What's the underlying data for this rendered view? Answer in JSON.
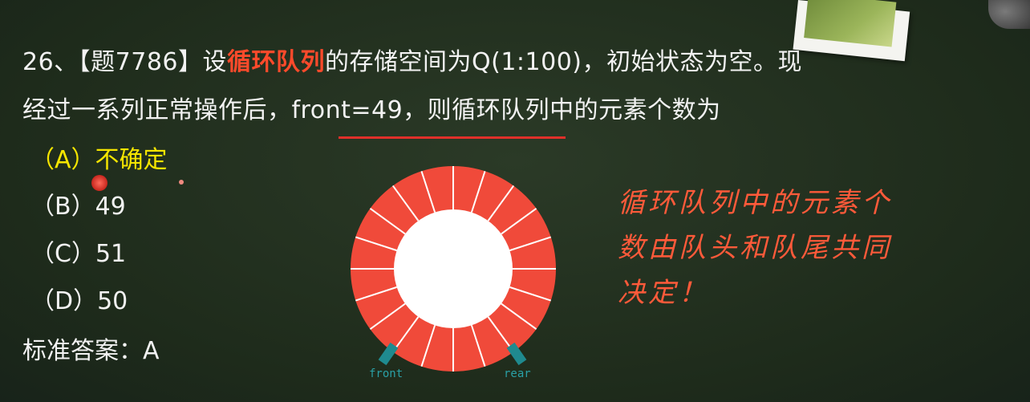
{
  "question": {
    "line1_prefix": "26、【题7786】设",
    "line1_highlight": "循环队列",
    "line1_suffix": "的存储空间为Q(1:100)，初始状态为空。现",
    "line2": "经过一系列正常操作后，front=49，则循环队列中的元素个数为"
  },
  "options": [
    {
      "label": "（A）不确定",
      "selected": true
    },
    {
      "label": "（B）49"
    },
    {
      "label": "（C）51"
    },
    {
      "label": "（D）50"
    }
  ],
  "answer": "标准答案：A",
  "diagram": {
    "front_label": "front",
    "rear_label": "rear",
    "segments": 20,
    "ring_color": "#f04a3a",
    "pointer_color": "#1f8a8f"
  },
  "note": {
    "line1": "循环队列中的元素个",
    "line2": "数由队头和队尾共同",
    "line3": "决定！"
  },
  "colors": {
    "highlight": "#ff4a2b",
    "selected_option": "#f5e500",
    "note": "#ff5a3a",
    "background": "#1f2d1c"
  }
}
